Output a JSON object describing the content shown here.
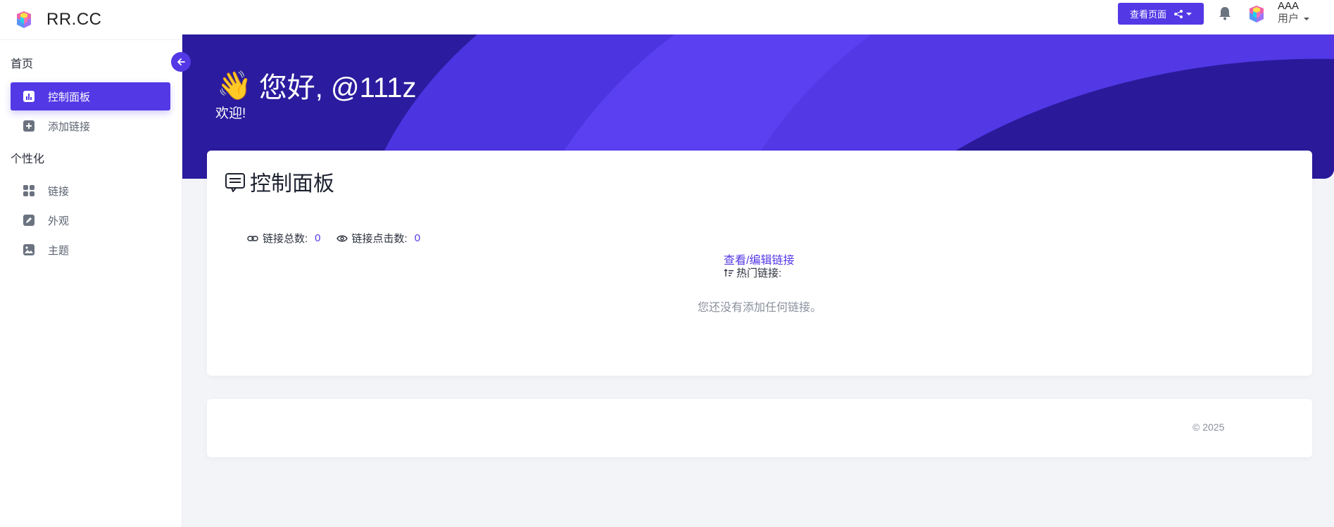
{
  "brand": {
    "name": "RR.CC"
  },
  "sidebar": {
    "home_section": "首页",
    "personal_section": "个性化",
    "items": [
      {
        "label": "控制面板",
        "icon": "chart-icon",
        "active": true
      },
      {
        "label": "添加链接",
        "icon": "plus-square-icon",
        "active": false
      },
      {
        "label": "链接",
        "icon": "grid-icon",
        "active": false
      },
      {
        "label": "外观",
        "icon": "edit-icon",
        "active": false
      },
      {
        "label": "主题",
        "icon": "image-icon",
        "active": false
      }
    ]
  },
  "topbar": {
    "view_page_label": "查看页面",
    "user_name": "AAA",
    "user_role": "用户"
  },
  "banner": {
    "emoji": "👋",
    "greeting": "您好, @111z",
    "welcome": "欢迎!"
  },
  "dashboard": {
    "title": "控制面板",
    "total_links_label": "链接总数:",
    "total_links_value": "0",
    "link_clicks_label": "链接点击数:",
    "link_clicks_value": "0",
    "edit_link": "查看/编辑链接",
    "hot_links_label": "热门链接:",
    "empty_message": "您还没有添加任何链接。"
  },
  "footer": {
    "copyright": "© 2025"
  },
  "colors": {
    "accent": "#5338e6",
    "banner": "#3522c0",
    "background": "#f3f4f8"
  }
}
